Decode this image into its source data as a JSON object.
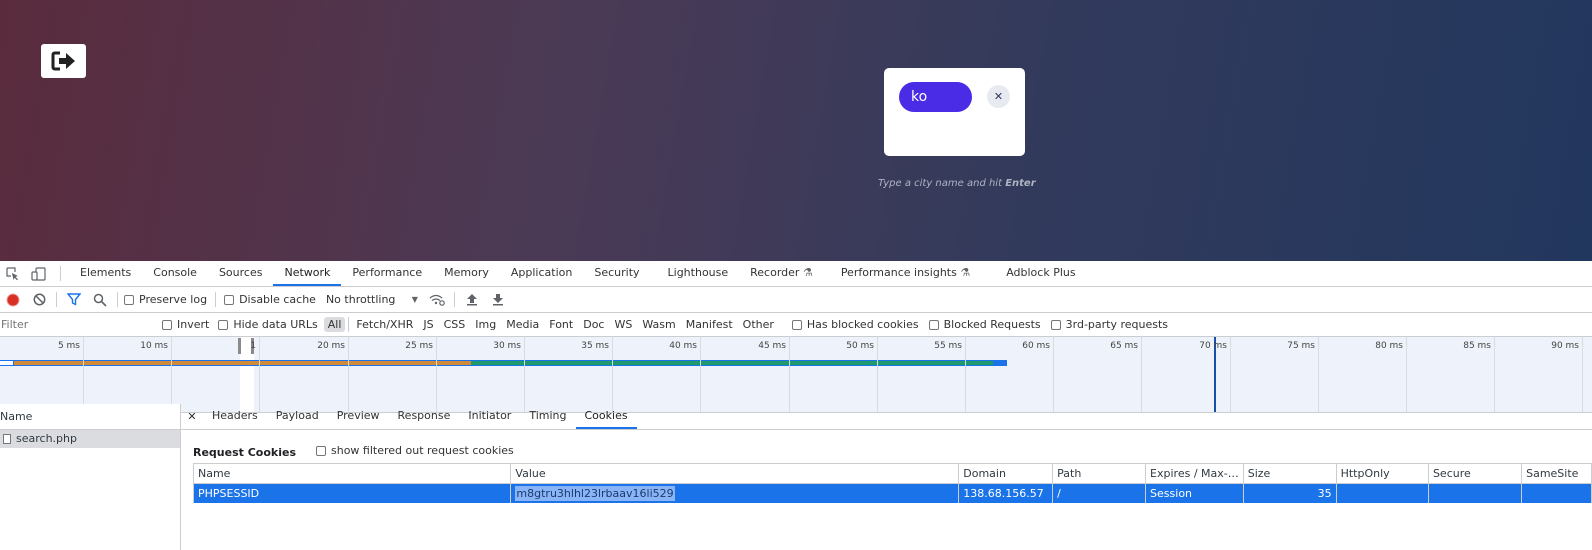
{
  "page": {
    "search_value": "ko",
    "hint_text": "Type a city name and hit ",
    "hint_key": "Enter"
  },
  "devtools": {
    "tabs": [
      "Elements",
      "Console",
      "Sources",
      "Network",
      "Performance",
      "Memory",
      "Application",
      "Security",
      "Lighthouse",
      "Recorder",
      "Performance insights",
      "Adblock Plus"
    ],
    "active_tab": "Network",
    "toolbar": {
      "preserve_log": "Preserve log",
      "disable_cache": "Disable cache",
      "throttling": "No throttling"
    },
    "filterbar": {
      "filter_placeholder": "Filter",
      "invert": "Invert",
      "hide_data_urls": "Hide data URLs",
      "types": [
        "All",
        "Fetch/XHR",
        "JS",
        "CSS",
        "Img",
        "Media",
        "Font",
        "Doc",
        "WS",
        "Wasm",
        "Manifest",
        "Other"
      ],
      "has_blocked_cookies": "Has blocked cookies",
      "blocked_requests": "Blocked Requests",
      "third_party": "3rd-party requests"
    },
    "timeline_ticks": [
      "5 ms",
      "10 ms",
      "1",
      "20 ms",
      "25 ms",
      "30 ms",
      "35 ms",
      "40 ms",
      "45 ms",
      "50 ms",
      "55 ms",
      "60 ms",
      "65 ms",
      "70 ms",
      "75 ms",
      "80 ms",
      "85 ms",
      "90 ms"
    ],
    "requests": {
      "header": "Name",
      "items": [
        "search.php"
      ]
    },
    "detail_tabs": [
      "Headers",
      "Payload",
      "Preview",
      "Response",
      "Initiator",
      "Timing",
      "Cookies"
    ],
    "active_detail_tab": "Cookies",
    "cookies": {
      "title": "Request Cookies",
      "show_filtered": "show filtered out request cookies",
      "columns": [
        "Name",
        "Value",
        "Domain",
        "Path",
        "Expires / Max-…",
        "Size",
        "HttpOnly",
        "Secure",
        "SameSite"
      ],
      "row": {
        "name": "PHPSESSID",
        "value": "m8gtru3hlhl23lrbaav16li529",
        "domain": "138.68.156.57",
        "path": "/",
        "expires": "Session",
        "size": "35",
        "httponly": "",
        "secure": "",
        "samesite": ""
      }
    }
  },
  "colors": {
    "accent": "#1a73e8",
    "search_pill": "#4a2be6",
    "record": "#d93025"
  }
}
